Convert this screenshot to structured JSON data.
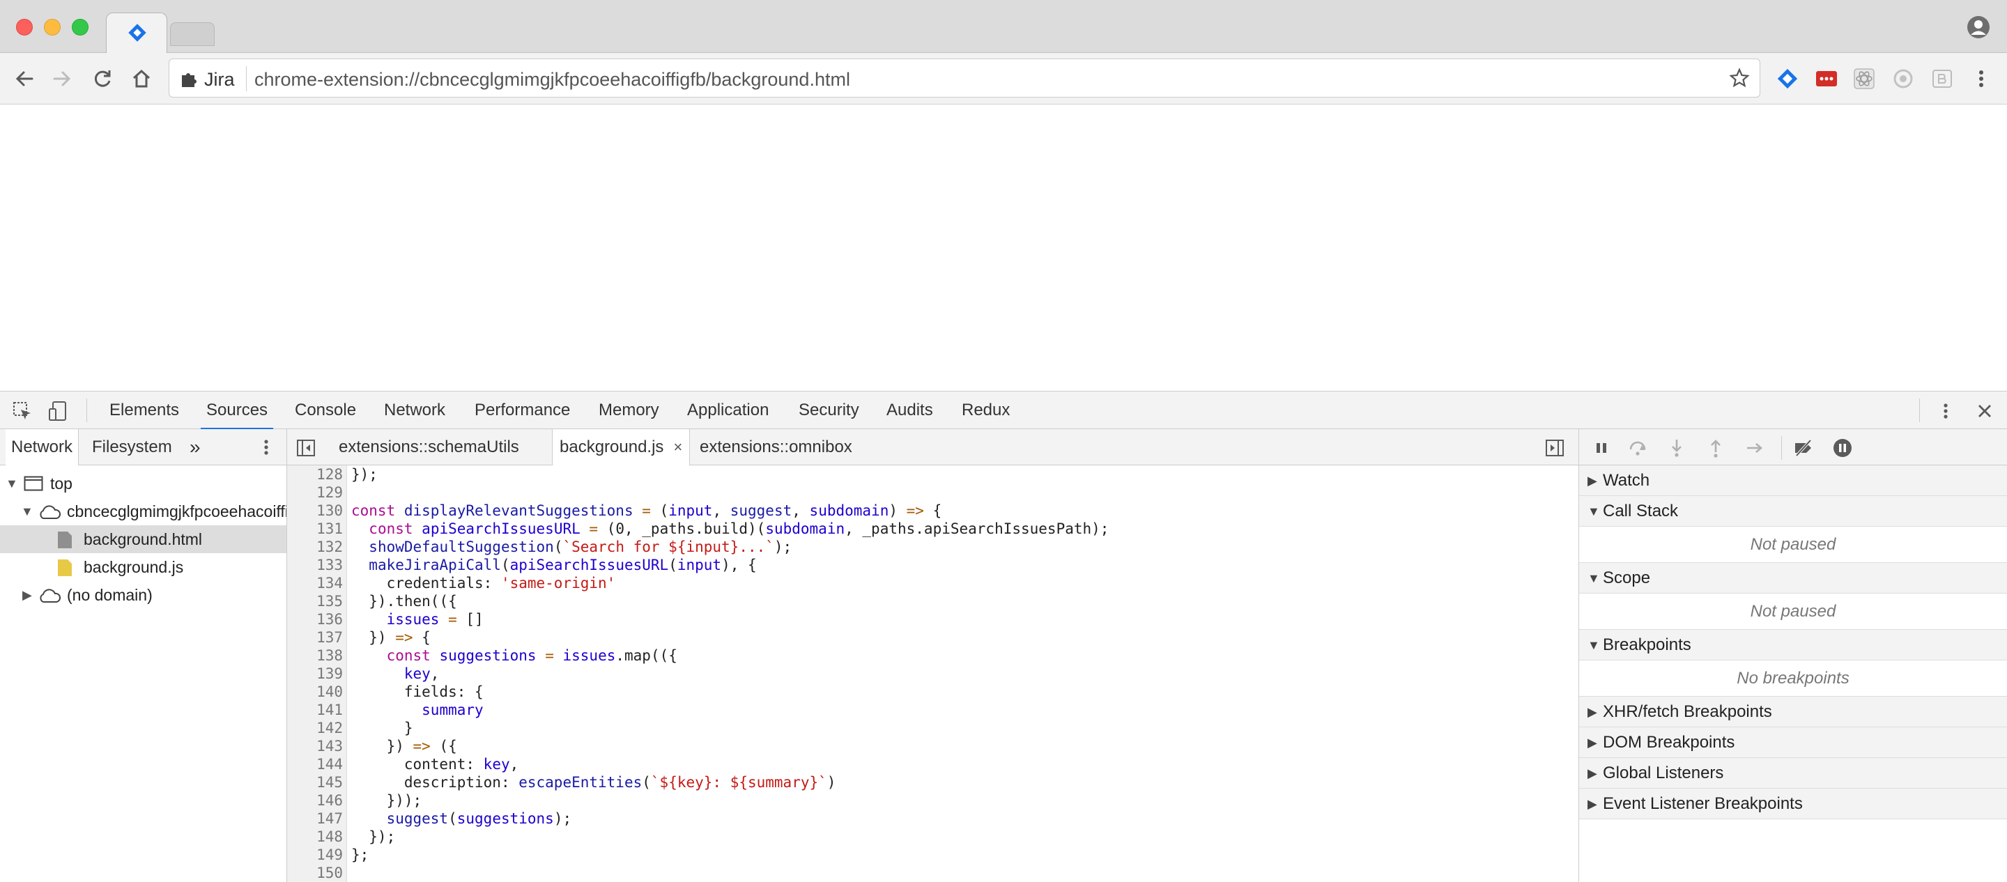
{
  "browser": {
    "site_name": "Jira",
    "url": "chrome-extension://cbncecglgmimgjkfpcoeehacoiffigfb/background.html",
    "colors": {
      "jira_blue": "#1a73e8",
      "close_red": "#fc605c",
      "minimize_yellow": "#fdbc40",
      "zoom_green": "#34c84a"
    },
    "toolbar_icons": [
      "back-icon",
      "forward-icon",
      "reload-icon",
      "home-icon",
      "extension-puzzle-icon",
      "bookmark-star-icon"
    ],
    "extension_icons": [
      "jira-extension-icon",
      "lastpass-extension-icon",
      "react-devtools-extension-icon",
      "redux-extension-icon",
      "extension-b-icon",
      "chrome-menu-icon"
    ]
  },
  "devtools": {
    "panels": [
      "Elements",
      "Sources",
      "Console",
      "Network",
      "Performance",
      "Memory",
      "Application",
      "Security",
      "Audits",
      "Redux"
    ],
    "active_panel": "Sources",
    "navigator": {
      "tabs": [
        "Network",
        "Filesystem"
      ],
      "more": "»",
      "tree": [
        {
          "label": "top"
        },
        {
          "label": "cbncecglgmimgjkfpcoeehacoiffigfb"
        },
        {
          "label": "background.html"
        },
        {
          "label": "background.js"
        },
        {
          "label": "(no domain)"
        }
      ]
    },
    "editor": {
      "tabs": [
        "extensions::schemaUtils",
        "background.js",
        "extensions::omnibox"
      ],
      "active_tab": "background.js",
      "close_glyph": "×",
      "line_numbers": [
        "128",
        "129",
        "130",
        "131",
        "132",
        "133",
        "134",
        "135",
        "136",
        "137",
        "138",
        "139",
        "140",
        "141",
        "142",
        "143",
        "144",
        "145",
        "146",
        "147",
        "148",
        "149",
        "150"
      ],
      "code_text": [
        "});",
        "",
        "const displayRelevantSuggestions = (input, suggest, subdomain) => {",
        "  const apiSearchIssuesURL = (0, _paths.build)(subdomain, _paths.apiSearchIssuesPath);",
        "  showDefaultSuggestion(`Search for ${input}...`);",
        "  makeJiraApiCall(apiSearchIssuesURL(input), {",
        "    credentials: 'same-origin'",
        "  }).then(({",
        "    issues = []",
        "  }) => {",
        "    const suggestions = issues.map(({",
        "      key,",
        "      fields: {",
        "        summary",
        "      }",
        "    }) => ({",
        "      content: key,",
        "      description: escapeEntities(`${key}: ${summary}`)",
        "    }));",
        "    suggest(suggestions);",
        "  });",
        "};",
        ""
      ]
    },
    "debugger": {
      "sections": [
        {
          "title": "Watch",
          "expanded": false
        },
        {
          "title": "Call Stack",
          "expanded": true,
          "body": "Not paused"
        },
        {
          "title": "Scope",
          "expanded": true,
          "body": "Not paused"
        },
        {
          "title": "Breakpoints",
          "expanded": true,
          "body": "No breakpoints"
        },
        {
          "title": "XHR/fetch Breakpoints",
          "expanded": false
        },
        {
          "title": "DOM Breakpoints",
          "expanded": false
        },
        {
          "title": "Global Listeners",
          "expanded": false
        },
        {
          "title": "Event Listener Breakpoints",
          "expanded": false
        }
      ]
    }
  }
}
